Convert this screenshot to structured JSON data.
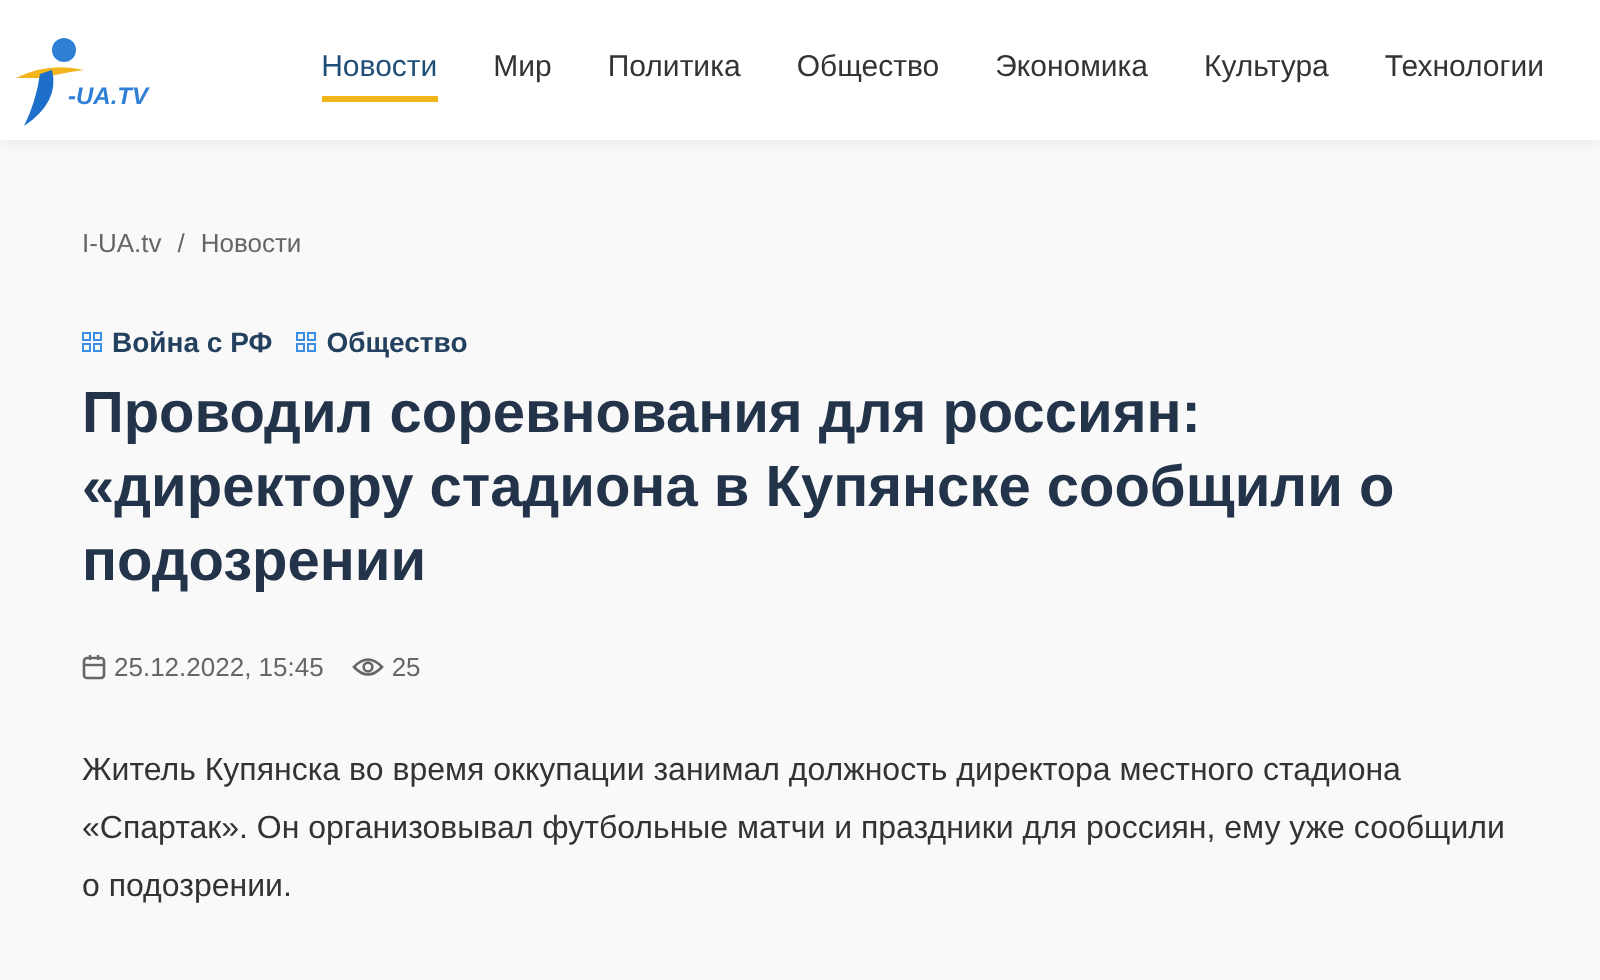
{
  "logo": {
    "text": "-UA.TV"
  },
  "nav": [
    {
      "label": "Новости",
      "selected": true
    },
    {
      "label": "Мир",
      "selected": false
    },
    {
      "label": "Политика",
      "selected": false
    },
    {
      "label": "Общество",
      "selected": false
    },
    {
      "label": "Экономика",
      "selected": false
    },
    {
      "label": "Культура",
      "selected": false
    },
    {
      "label": "Технологии",
      "selected": false
    }
  ],
  "breadcrumbs": [
    "I-UA.tv",
    "Новости"
  ],
  "breadcrumb_separator": "/",
  "tags": [
    "Война с РФ",
    "Общество"
  ],
  "article": {
    "title": "Проводил соревнования для россиян: «директору стадиона в Купянске сообщили о подозрении",
    "date": "25.12.2022, 15:45",
    "views": "25",
    "lead": "Житель Купянска во время оккупации занимал должность директора местного стадиона «Спартак». Он организовывал футбольные матчи и праздники для россиян, ему уже сообщили о подозрении."
  }
}
